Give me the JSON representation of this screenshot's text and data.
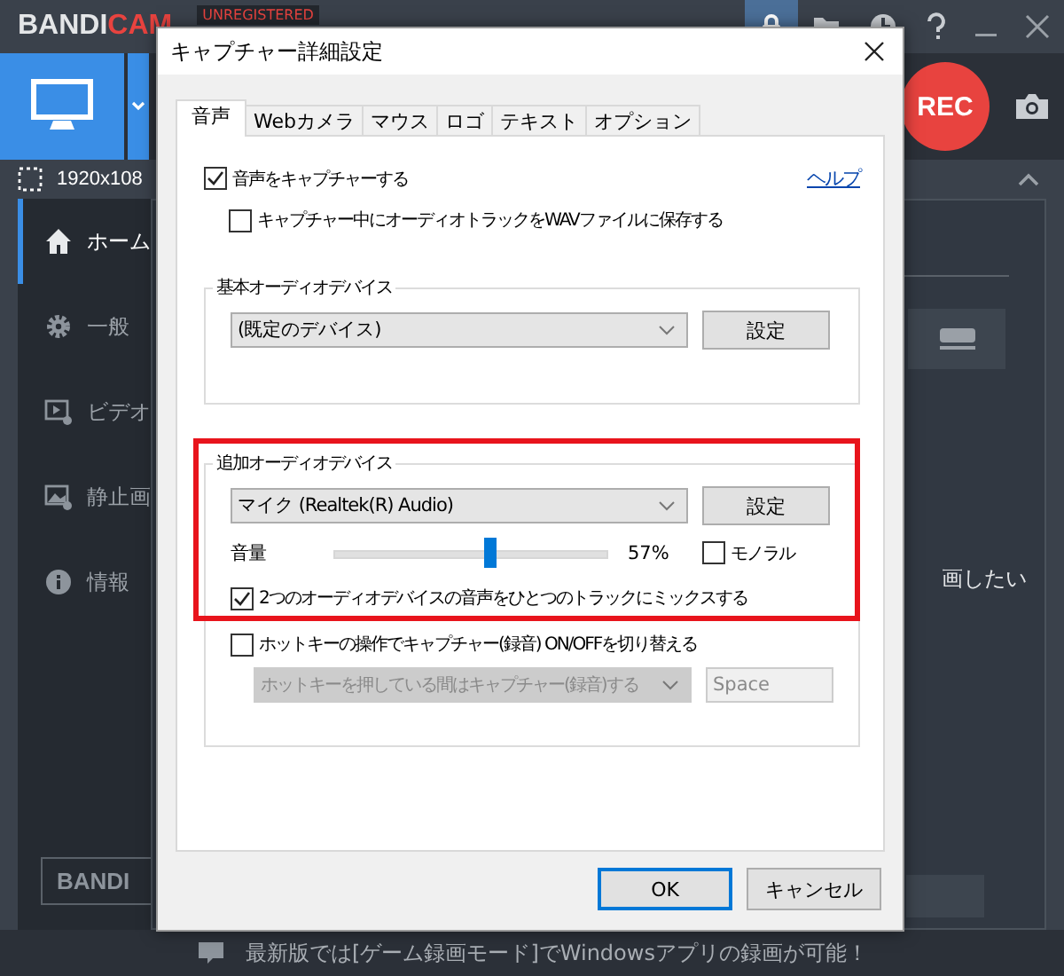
{
  "app": {
    "logo_main": "BANDI",
    "logo_accent": "CAM",
    "badge": "UNREGISTERED",
    "record_button": "REC",
    "resolution": "1920x108",
    "sidebar": [
      {
        "label": "ホーム",
        "selected": true
      },
      {
        "label": "一般",
        "selected": false
      },
      {
        "label": "ビデオ",
        "selected": false
      },
      {
        "label": "静止画",
        "selected": false
      },
      {
        "label": "情報",
        "selected": false
      }
    ],
    "content_text": "画したい",
    "footer_logo": "BANDI",
    "notice": "最新版では[ゲーム録画モード]でWindowsアプリの録画が可能！"
  },
  "dialog": {
    "title": "キャプチャー詳細設定",
    "tabs": [
      {
        "label": "音声",
        "selected": true
      },
      {
        "label": "Webカメラ",
        "selected": false
      },
      {
        "label": "マウス",
        "selected": false
      },
      {
        "label": "ロゴ",
        "selected": false
      },
      {
        "label": "テキスト",
        "selected": false
      },
      {
        "label": "オプション",
        "selected": false
      }
    ],
    "capture_audio": {
      "label": "音声をキャプチャーする",
      "checked": true
    },
    "help_link": "ヘルプ",
    "save_wav": {
      "label": "キャプチャー中にオーディオトラックをWAVファイルに保存する",
      "checked": false
    },
    "primary_group": {
      "title": "基本オーディオデバイス",
      "device": "(既定のデバイス)",
      "button": "設定"
    },
    "secondary_group": {
      "title": "追加オーディオデバイス",
      "highlighted": true,
      "device": "マイク (Realtek(R) Audio)",
      "button": "設定",
      "volume_label": "音量",
      "volume": {
        "level": 0.57
      },
      "reading": "57%",
      "mono": {
        "label": "モノラル",
        "checked": false
      },
      "mix": {
        "label": "2つのオーディオデバイスの音声をひとつのトラックにミックスする",
        "checked": true
      }
    },
    "hotkey": {
      "label": "ホットキーの操作でキャプチャー(録音) ON/OFFを切り替える",
      "checked": false,
      "mode": "ホットキーを押している間はキャプチャー(録音)する",
      "key": "Space",
      "disabled": true
    },
    "buttons": [
      {
        "label": "OK",
        "default": true
      },
      {
        "label": "キャンセル",
        "default": false
      }
    ]
  }
}
